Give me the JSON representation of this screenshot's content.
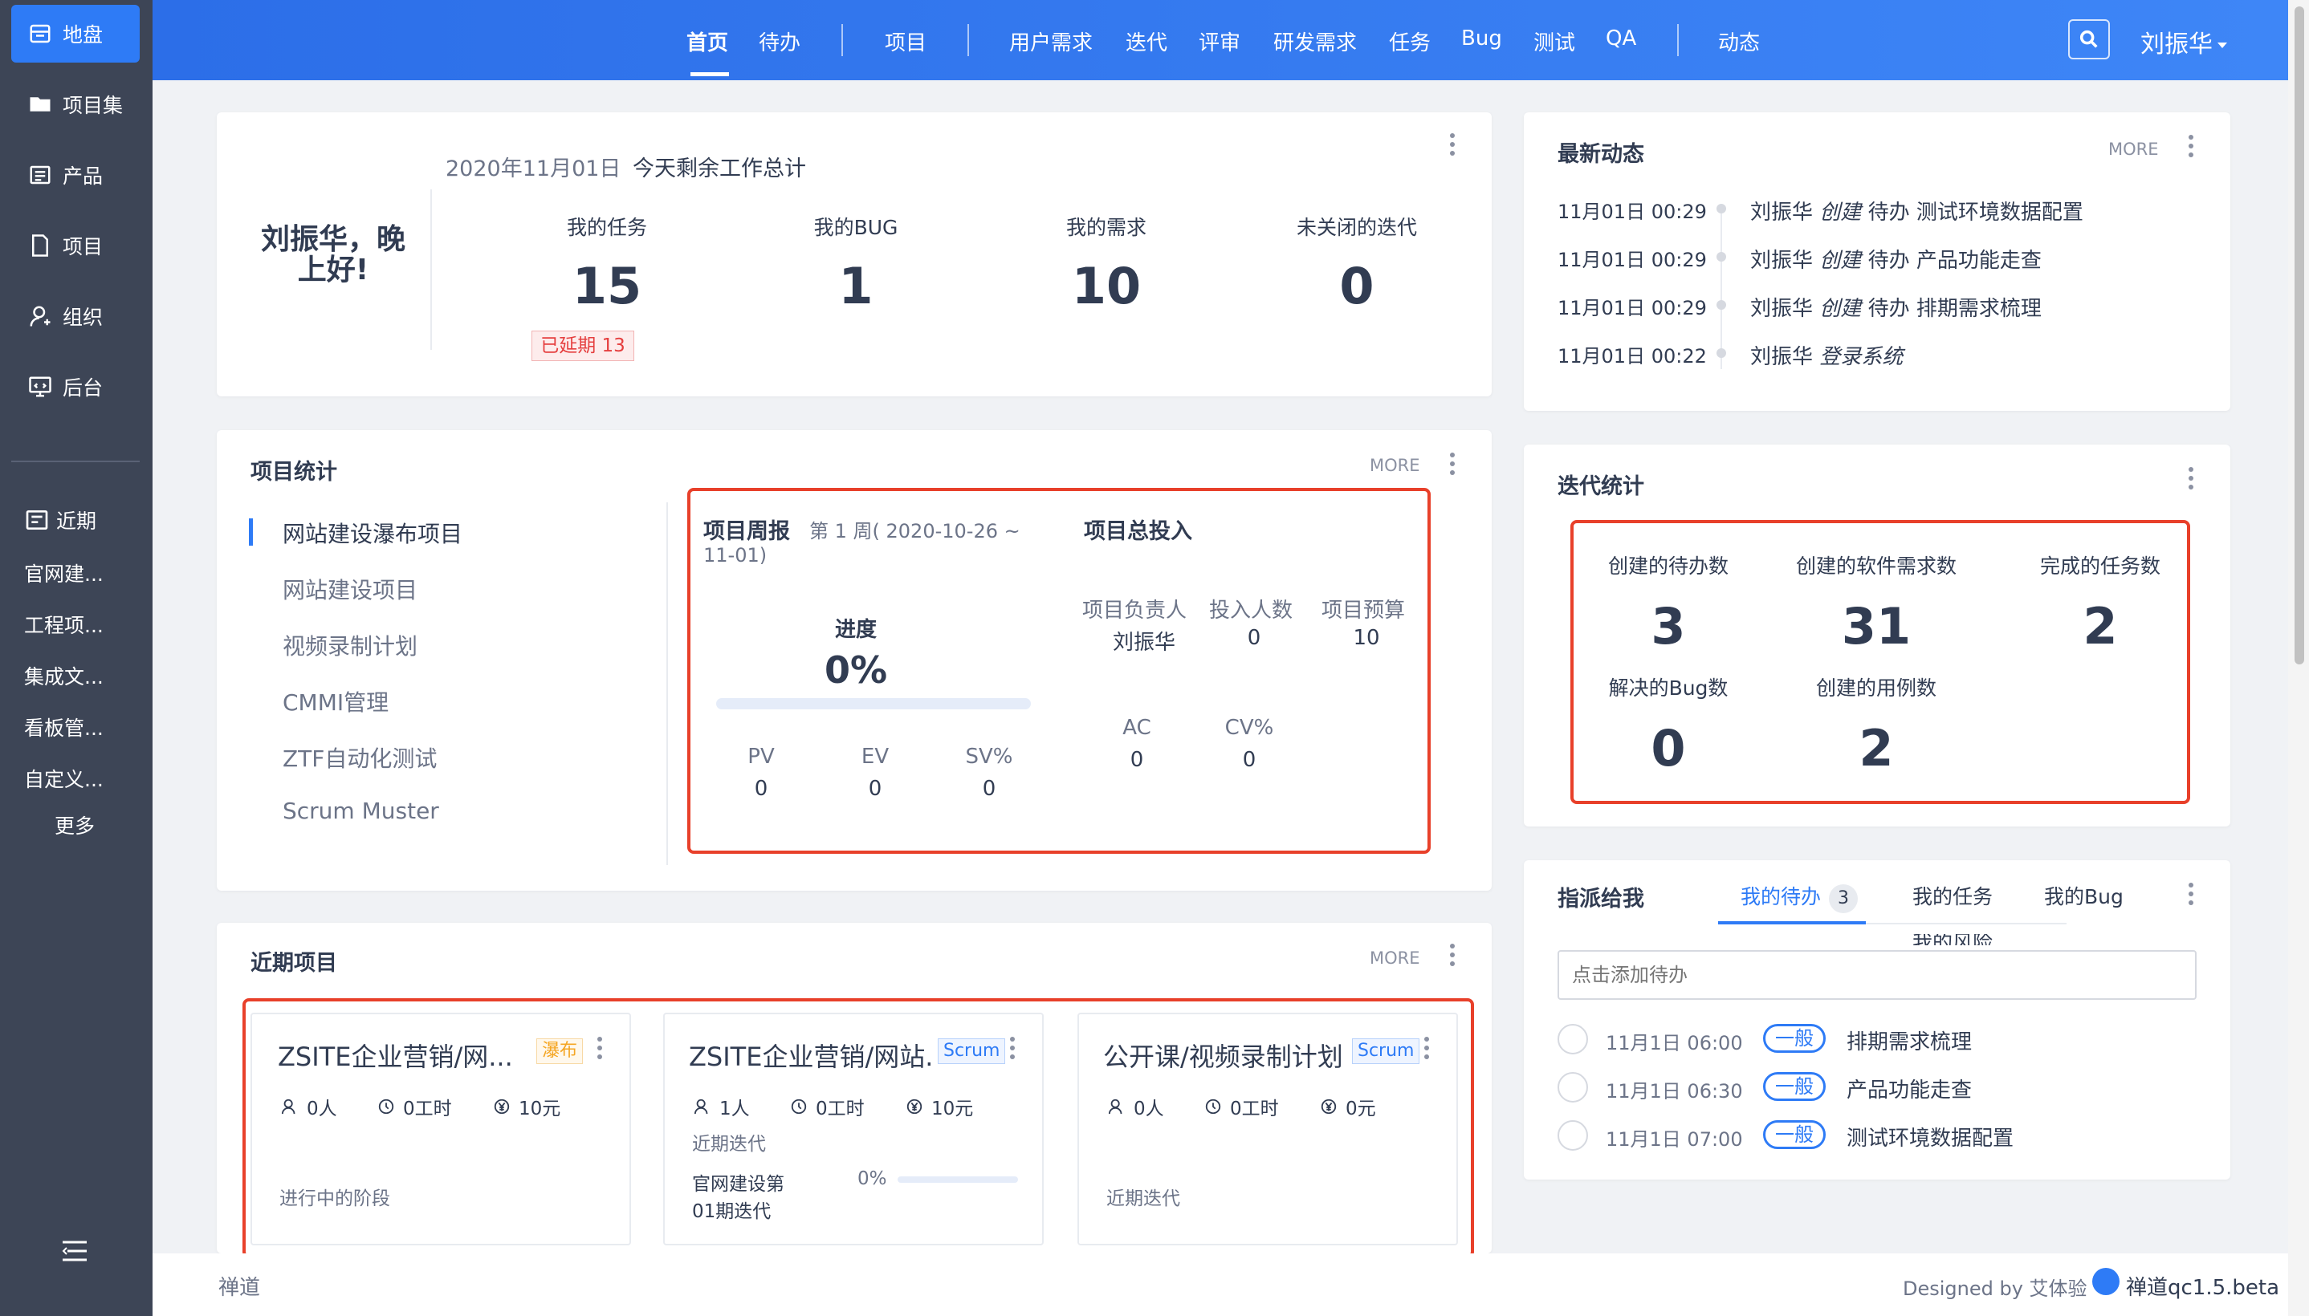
{
  "colors": {
    "primary": "#2e7bf6",
    "sidebar": "#3d4556",
    "highlight": "#e8402a",
    "warning": "#f5a623"
  },
  "sidebar": {
    "items": [
      {
        "label": "地盘",
        "icon": "home-icon"
      },
      {
        "label": "项目集",
        "icon": "folder-icon"
      },
      {
        "label": "产品",
        "icon": "product-icon"
      },
      {
        "label": "项目",
        "icon": "file-icon"
      },
      {
        "label": "组织",
        "icon": "user-icon"
      },
      {
        "label": "后台",
        "icon": "monitor-icon"
      }
    ],
    "recent_label": "近期",
    "recent": [
      "官网建...",
      "工程项...",
      "集成文...",
      "看板管...",
      "自定义..."
    ],
    "more": "更多"
  },
  "topnav": {
    "items": [
      "首页",
      "待办",
      "项目",
      "用户需求",
      "迭代",
      "评审",
      "研发需求",
      "任务",
      "Bug",
      "测试",
      "QA",
      "动态"
    ],
    "user": "刘振华"
  },
  "welcome": {
    "greeting": "刘振华，晚上好!",
    "date": "2020年11月01日",
    "subtitle": "今天剩余工作总计",
    "stats": [
      {
        "label": "我的任务",
        "value": "15"
      },
      {
        "label": "我的BUG",
        "value": "1"
      },
      {
        "label": "我的需求",
        "value": "10"
      },
      {
        "label": "未关闭的迭代",
        "value": "0"
      }
    ],
    "delayed": "已延期 13"
  },
  "activity": {
    "title": "最新动态",
    "more": "MORE",
    "items": [
      {
        "time": "11月01日 00:29",
        "user": "刘振华",
        "action": "创建",
        "text": "待办 测试环境数据配置"
      },
      {
        "time": "11月01日 00:29",
        "user": "刘振华",
        "action": "创建",
        "text": "待办 产品功能走查"
      },
      {
        "time": "11月01日 00:29",
        "user": "刘振华",
        "action": "创建",
        "text": "待办 排期需求梳理"
      },
      {
        "time": "11月01日 00:22",
        "user": "刘振华",
        "action": "登录系统",
        "text": ""
      }
    ]
  },
  "project_stats": {
    "title": "项目统计",
    "more": "MORE",
    "projects": [
      "网站建设瀑布项目",
      "网站建设项目",
      "视频录制计划",
      "CMMI管理",
      "ZTF自动化测试",
      "Scrum Muster"
    ],
    "weekly_title": "项目周报",
    "weekly_range_1": "第 1 周( 2020-10-26 ~",
    "weekly_range_2": "11-01)",
    "progress_label": "进度",
    "progress": "0%",
    "progress_value": 0,
    "pv_label": "PV",
    "pv": "0",
    "ev_label": "EV",
    "ev": "0",
    "sv_label": "SV%",
    "sv": "0",
    "invest_title": "项目总投入",
    "owner_label": "项目负责人",
    "owner": "刘振华",
    "people_label": "投入人数",
    "people": "0",
    "budget_label": "项目预算",
    "budget": "10",
    "ac_label": "AC",
    "ac": "0",
    "cv_label": "CV%",
    "cv": "0"
  },
  "iteration_stats": {
    "title": "迭代统计",
    "items": [
      {
        "label": "创建的待办数",
        "value": "3"
      },
      {
        "label": "创建的软件需求数",
        "value": "31"
      },
      {
        "label": "完成的任务数",
        "value": "2"
      },
      {
        "label": "解决的Bug数",
        "value": "0"
      },
      {
        "label": "创建的用例数",
        "value": "2"
      }
    ]
  },
  "recent_projects": {
    "title": "近期项目",
    "more": "MORE",
    "cards": [
      {
        "title": "ZSITE企业营销/网...",
        "tag": "瀑布",
        "people": "0人",
        "hours": "0工时",
        "budget": "10元",
        "footer": "进行中的阶段"
      },
      {
        "title": "ZSITE企业营销/网站.",
        "tag": "Scrum",
        "people": "1人",
        "hours": "0工时",
        "budget": "10元",
        "sub": "近期迭代",
        "iter_1": "官网建设第",
        "iter_2": "01期迭代",
        "iter_pct": "0%"
      },
      {
        "title": "公开课/视频录制计划",
        "tag": "Scrum",
        "people": "0人",
        "hours": "0工时",
        "budget": "0元",
        "footer": "近期迭代"
      }
    ]
  },
  "assign": {
    "title": "指派给我",
    "tabs": [
      "我的待办",
      "我的任务",
      "我的Bug"
    ],
    "badge": "3",
    "overflow": "我的风险",
    "placeholder": "点击添加待办",
    "todos": [
      {
        "time": "11月1日 06:00",
        "pri": "一般",
        "title": "排期需求梳理"
      },
      {
        "time": "11月1日 06:30",
        "pri": "一般",
        "title": "产品功能走查"
      },
      {
        "time": "11月1日 07:00",
        "pri": "一般",
        "title": "测试环境数据配置"
      }
    ]
  },
  "footer": {
    "left": "禅道",
    "designed": "Designed by 艾体验",
    "version": "禅道qc1.5.beta"
  }
}
